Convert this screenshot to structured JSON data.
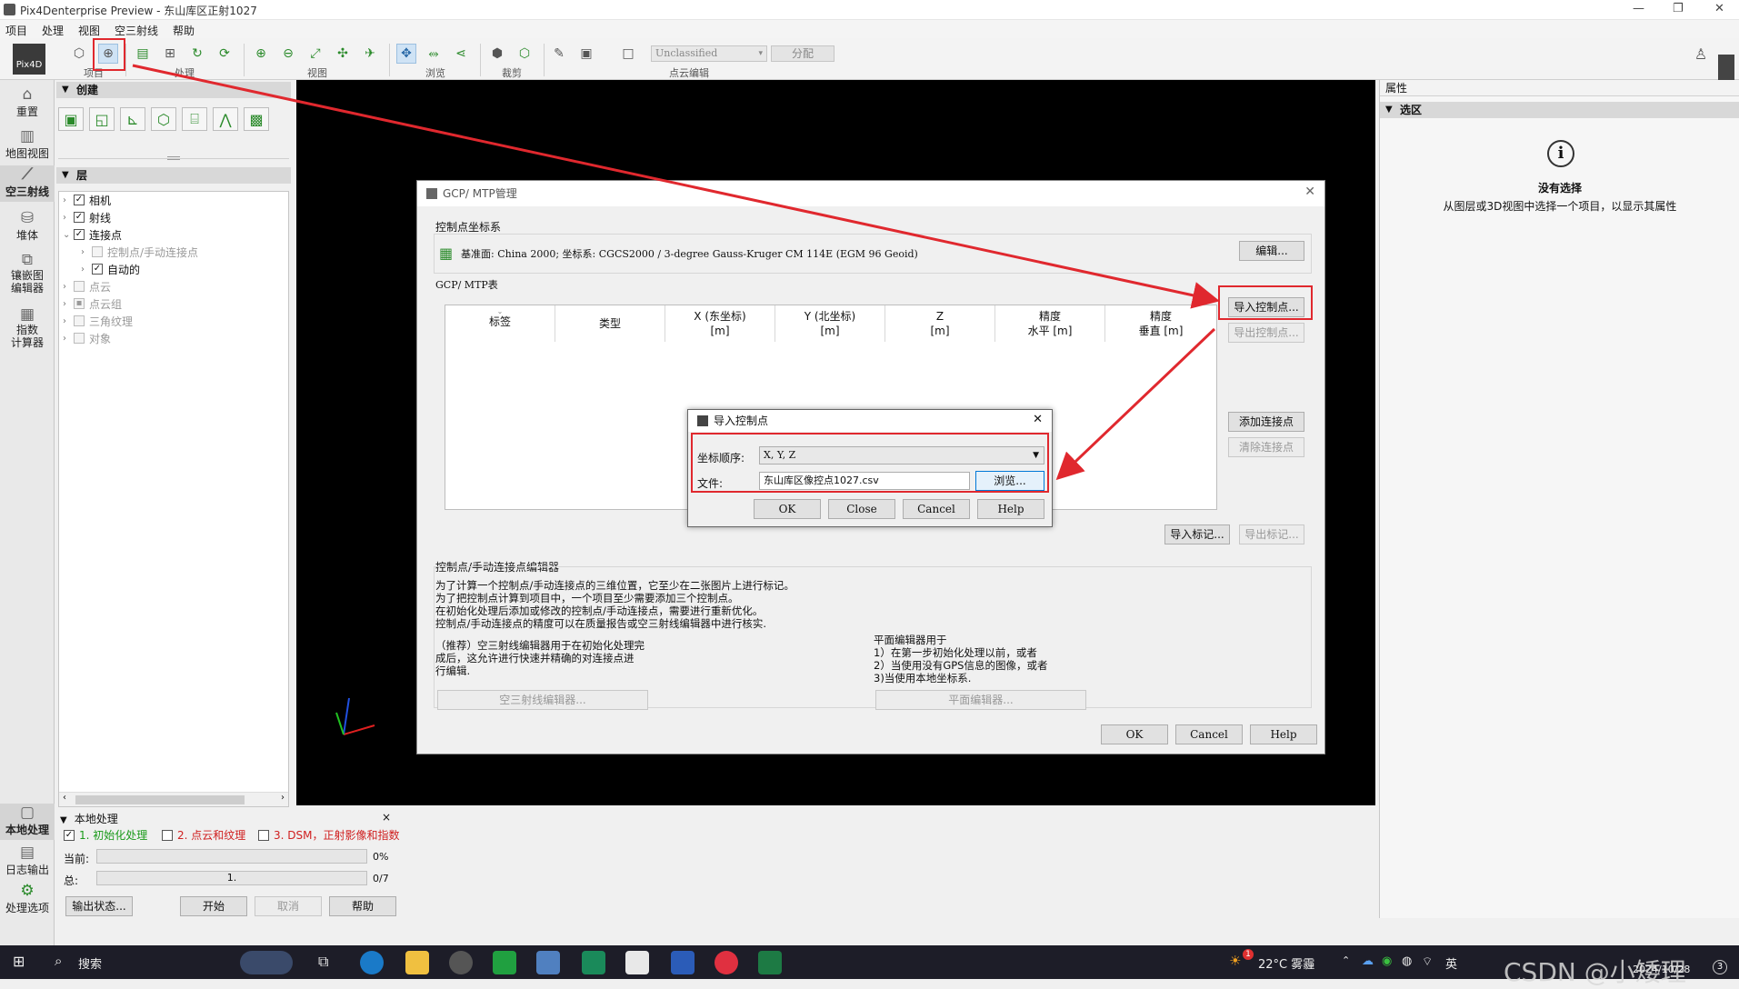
{
  "window": {
    "title": "Pix4Denterprise Preview - 东山库区正射1027"
  },
  "menu": [
    "项目",
    "处理",
    "视图",
    "空三射线",
    "帮助"
  ],
  "toolbar": {
    "groups": [
      "项目",
      "处理",
      "视图",
      "浏览",
      "裁剪",
      "点云编辑"
    ],
    "class_select": "Unclassified",
    "assign_label": "分配"
  },
  "logo_text": "Pix4D",
  "left_rail": [
    {
      "label": "重置",
      "icon": "home-icon"
    },
    {
      "label": "地图视图",
      "icon": "map-icon"
    },
    {
      "label": "空三射线",
      "icon": "rays-icon"
    },
    {
      "label": "堆体",
      "icon": "volume-icon"
    },
    {
      "label": "镶嵌图\n编辑器",
      "icon": "mosaic-icon"
    },
    {
      "label": "指数\n计算器",
      "icon": "calculator-icon"
    },
    {
      "label": "本地处理",
      "icon": "local-processing-icon"
    },
    {
      "label": "日志输出",
      "icon": "log-icon"
    },
    {
      "label": "处理选项",
      "icon": "gear-icon"
    }
  ],
  "create_section": {
    "title": "创建"
  },
  "layers_section": {
    "title": "层",
    "items": [
      {
        "label": "相机",
        "checked": true,
        "enabled": true
      },
      {
        "label": "射线",
        "checked": true,
        "enabled": true
      },
      {
        "label": "连接点",
        "checked": true,
        "enabled": true
      },
      {
        "label": "控制点/手动连接点",
        "checked": false,
        "enabled": false
      },
      {
        "label": "自动的",
        "checked": true,
        "enabled": true
      },
      {
        "label": "点云",
        "checked": false,
        "enabled": false
      },
      {
        "label": "点云组",
        "checked": false,
        "enabled": false
      },
      {
        "label": "三角纹理",
        "checked": false,
        "enabled": false
      },
      {
        "label": "对象",
        "checked": false,
        "enabled": false
      }
    ]
  },
  "properties": {
    "title": "属性",
    "section": "选区",
    "no_selection_title": "没有选择",
    "no_selection_desc": "从图层或3D视图中选择一个项目，以显示其属性"
  },
  "gcp_dialog": {
    "title": "GCP/ MTP管理",
    "coord_group": "控制点坐标系",
    "coord_text": "基准面: China 2000; 坐标系: CGCS2000 / 3-degree Gauss-Kruger CM 114E (EGM 96 Geoid)",
    "edit_btn": "编辑...",
    "table_group": "GCP/ MTP表",
    "columns": [
      "标签",
      "类型",
      "X (东坐标)\n[m]",
      "Y (北坐标)\n[m]",
      "Z\n[m]",
      "精度\n水平 [m]",
      "精度\n垂直 [m]"
    ],
    "import_btn": "导入控制点...",
    "export_btn": "导出控制点...",
    "add_tie_btn": "添加连接点",
    "remove_tie_btn": "清除连接点",
    "import_marks_btn": "导入标记...",
    "export_marks_btn": "导出标记...",
    "editor_group": "控制点/手动连接点编辑器",
    "editor_desc": [
      "为了计算一个控制点/手动连接点的三维位置，它至少在二张图片上进行标记。",
      "为了把控制点计算到项目中，一个项目至少需要添加三个控制点。",
      "在初始化处理后添加或修改的控制点/手动连接点，需要进行重新优化。",
      "控制点/手动连接点的精度可以在质量报告或空三射线编辑器中进行核实."
    ],
    "ray_desc": [
      "（推荐）空三射线编辑器用于在初始化处理完",
      "成后，这允许进行快速并精确的对连接点进",
      "行编辑."
    ],
    "ray_btn": "空三射线编辑器...",
    "plane_desc": [
      "平面编辑器用于",
      "1）在第一步初始化处理以前，或者",
      "2）当使用没有GPS信息的图像，或者",
      "3)当使用本地坐标系."
    ],
    "plane_btn": "平面编辑器...",
    "ok": "OK",
    "cancel": "Cancel",
    "help": "Help"
  },
  "import_dialog": {
    "title": "导入控制点",
    "order_label": "坐标顺序:",
    "order_value": "X, Y, Z",
    "file_label": "文件:",
    "file_value": "东山库区像控点1027.csv",
    "browse": "浏览...",
    "ok": "OK",
    "close": "Close",
    "cancel": "Cancel",
    "help": "Help"
  },
  "local_processing": {
    "title": "本地处理",
    "steps": [
      {
        "label": "1. 初始化处理",
        "checked": true,
        "color": "#1a9a1a"
      },
      {
        "label": "2. 点云和纹理",
        "checked": false,
        "color": "#d02020"
      },
      {
        "label": "3. DSM，正射影像和指数",
        "checked": false,
        "color": "#d02020"
      }
    ],
    "current_label": "当前:",
    "current_value": "0%",
    "current_progress": 0,
    "total_label": "总:",
    "total_bar": "1.",
    "total_value": "0/7",
    "output_status": "输出状态...",
    "start": "开始",
    "cancel": "取消",
    "help": "帮助"
  },
  "taskbar": {
    "search": "搜索",
    "weather": "22°C 雾霾",
    "weather_badge": "1",
    "ime": "英",
    "date": "2024/10/28",
    "watermark": "CSDN @小矮理",
    "notif_badge": "3"
  },
  "colors": {
    "accent_red": "#e0282e",
    "green": "#1a9a1a"
  }
}
